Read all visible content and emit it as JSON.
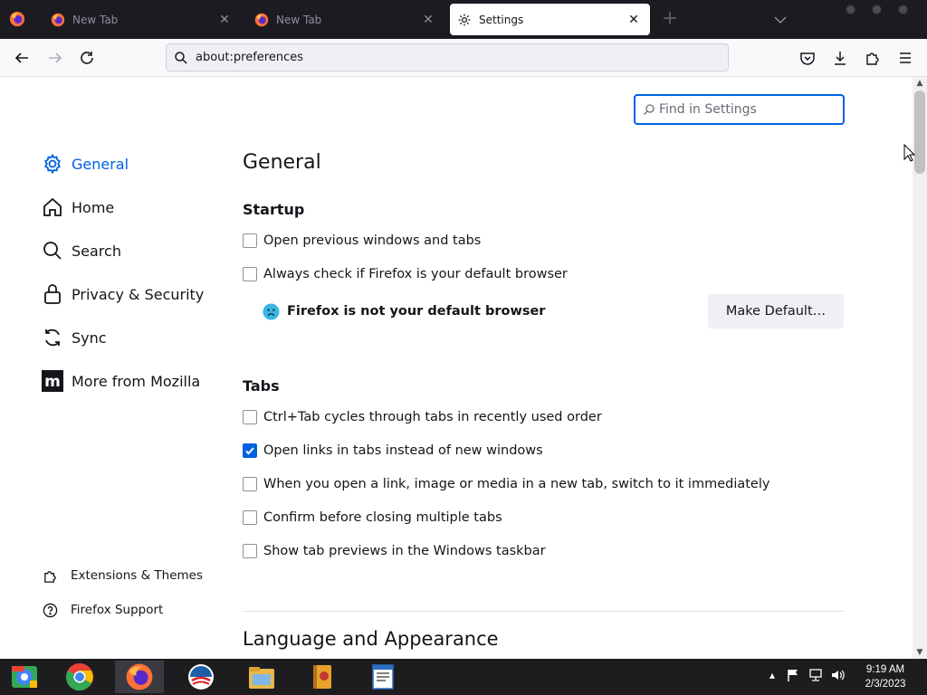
{
  "tabs": [
    {
      "title": "New Tab",
      "active": false
    },
    {
      "title": "New Tab",
      "active": false
    },
    {
      "title": "Settings",
      "active": true
    }
  ],
  "urlbar": {
    "url": "about:preferences"
  },
  "search": {
    "placeholder": "Find in Settings"
  },
  "sidebar": {
    "categories": [
      {
        "label": "General",
        "icon": "gear-icon",
        "selected": true
      },
      {
        "label": "Home",
        "icon": "home-icon"
      },
      {
        "label": "Search",
        "icon": "search-icon"
      },
      {
        "label": "Privacy & Security",
        "icon": "lock-icon"
      },
      {
        "label": "Sync",
        "icon": "sync-icon"
      },
      {
        "label": "More from Mozilla",
        "icon": "mozilla-icon"
      }
    ],
    "footer": [
      {
        "label": "Extensions & Themes",
        "icon": "puzzle-icon"
      },
      {
        "label": "Firefox Support",
        "icon": "help-icon"
      }
    ]
  },
  "main": {
    "heading": "General",
    "startup": {
      "heading": "Startup",
      "open_previous": {
        "label": "Open previous windows and tabs",
        "checked": false
      },
      "always_check": {
        "label": "Always check if Firefox is your default browser",
        "checked": false
      },
      "not_default": "Firefox is not your default browser",
      "make_default": "Make Default…"
    },
    "tabs_section": {
      "heading": "Tabs",
      "options": [
        {
          "label": "Ctrl+Tab cycles through tabs in recently used order",
          "checked": false
        },
        {
          "label": "Open links in tabs instead of new windows",
          "checked": true
        },
        {
          "label": "When you open a link, image or media in a new tab, switch to it immediately",
          "checked": false
        },
        {
          "label": "Confirm before closing multiple tabs",
          "checked": false
        },
        {
          "label": "Show tab previews in the Windows taskbar",
          "checked": false
        }
      ]
    },
    "language_heading": "Language and Appearance"
  },
  "taskbar": {
    "apps": [
      "chrome-os-icon",
      "chrome-icon",
      "firefox-icon",
      "obama-icon",
      "explorer-icon",
      "book-icon",
      "document-icon"
    ],
    "active_app": "firefox-icon",
    "clock": {
      "time": "9:19 AM",
      "date": "2/3/2023"
    }
  },
  "colors": {
    "accent": "#0061e0",
    "tabstrip": "#1c1b22",
    "taskbar": "#1d1d20"
  }
}
